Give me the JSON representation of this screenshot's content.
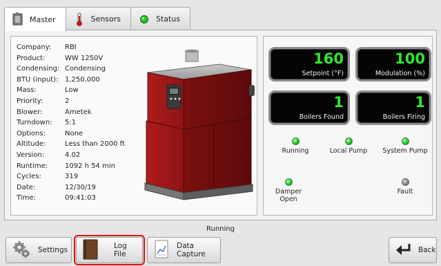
{
  "tabs": [
    {
      "label": "Master",
      "icon": "boiler-icon",
      "active": true
    },
    {
      "label": "Sensors",
      "icon": "thermometer-icon",
      "active": false
    },
    {
      "label": "Status",
      "icon": "green-dot-icon",
      "active": false
    }
  ],
  "info": [
    {
      "key": "Company:",
      "value": "RBI"
    },
    {
      "key": "Product:",
      "value": "WW 1250V"
    },
    {
      "key": "Condensing:",
      "value": "Condensing"
    },
    {
      "key": "BTU (input):",
      "value": "1,250,000"
    },
    {
      "key": "Mass:",
      "value": "Low"
    },
    {
      "key": "Priority:",
      "value": "2"
    },
    {
      "key": "Blower:",
      "value": "Ametek"
    },
    {
      "key": "Turndown:",
      "value": "5:1"
    },
    {
      "key": "Options:",
      "value": "None"
    },
    {
      "key": "Altitude:",
      "value": "Less than 2000 ft"
    },
    {
      "key": "Version:",
      "value": "4.02"
    },
    {
      "key": "Runtime:",
      "value": "1092 h 54 min"
    },
    {
      "key": "Cycles:",
      "value": "319"
    },
    {
      "key": "Date:",
      "value": "12/30/19"
    },
    {
      "key": "Time:",
      "value": "09:41:03"
    }
  ],
  "displays": {
    "setpoint": {
      "value": "160",
      "label": "Setpoint (°F)"
    },
    "modulation": {
      "value": "100",
      "label": "Modulation (%)"
    },
    "boilers_found": {
      "value": "1",
      "label": "Boilers Found"
    },
    "boilers_firing": {
      "value": "1",
      "label": "Boilers Firing"
    }
  },
  "indicators": {
    "running": {
      "label": "Running",
      "on": true
    },
    "local_pump": {
      "label": "Local Pump",
      "on": true
    },
    "system_pump": {
      "label": "System Pump",
      "on": true
    },
    "damper_open": {
      "label": "Damper Open",
      "on": true
    },
    "fault": {
      "label": "Fault",
      "on": false
    }
  },
  "status_text": "Running",
  "buttons": {
    "settings": "Settings",
    "log_file": "Log File",
    "data_capture": "Data Capture",
    "back": "Back"
  },
  "colors": {
    "display_digits": "#32e632",
    "led_on": "#22c12a",
    "highlight": "#e01010",
    "boiler_red": "#a31a1a"
  }
}
